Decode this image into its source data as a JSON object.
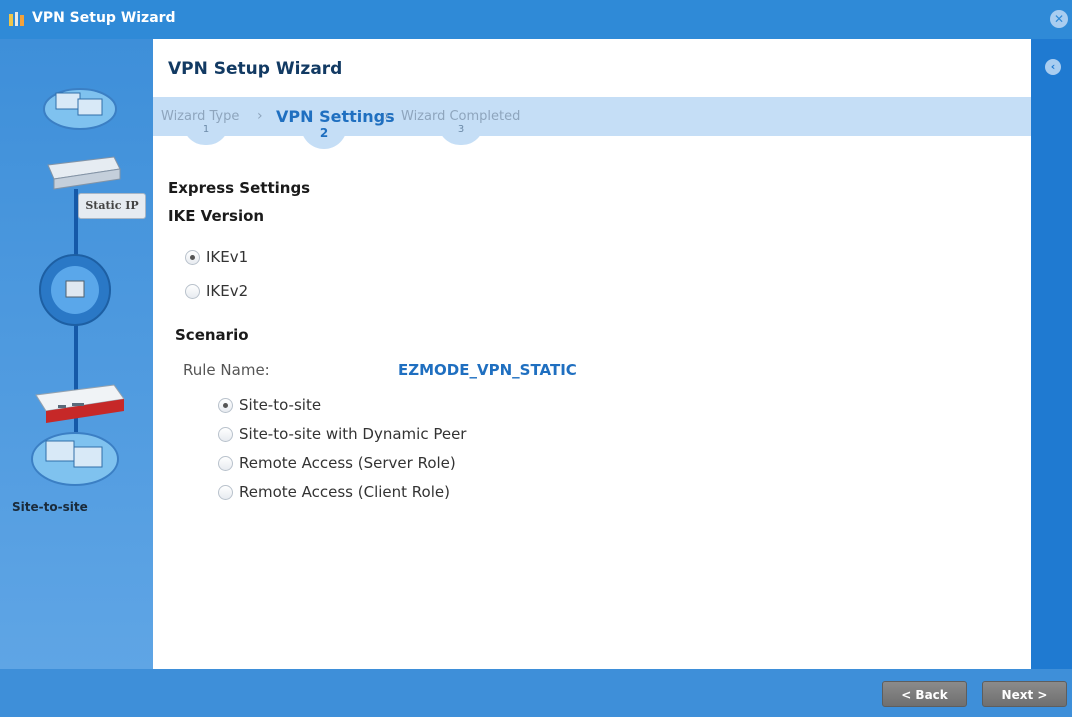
{
  "window": {
    "title": "VPN Setup Wizard",
    "close_icon": "close-icon"
  },
  "sidebar": {
    "static_ip_label": "Static IP",
    "scenario_label": "Site-to-site"
  },
  "main": {
    "title": "VPN Setup Wizard",
    "steps": [
      {
        "label": "Wizard Type",
        "number": "1",
        "active": false
      },
      {
        "label": "VPN Settings",
        "number": "2",
        "active": true
      },
      {
        "label": "Wizard Completed",
        "number": "3",
        "active": false
      }
    ],
    "express_settings": "Express Settings",
    "ike": {
      "heading": "IKE Version",
      "options": [
        {
          "label": "IKEv1",
          "checked": true
        },
        {
          "label": "IKEv2",
          "checked": false
        }
      ]
    },
    "scenario": {
      "heading": "Scenario",
      "rule_name_label": "Rule Name:",
      "rule_name_value": "EZMODE_VPN_STATIC",
      "options": [
        {
          "label": "Site-to-site",
          "checked": true
        },
        {
          "label": "Site-to-site with Dynamic Peer",
          "checked": false
        },
        {
          "label": "Remote Access (Server Role)",
          "checked": false
        },
        {
          "label": "Remote Access (Client Role)",
          "checked": false
        }
      ]
    }
  },
  "footer": {
    "back_label": "< Back",
    "next_label": "Next >"
  },
  "colors": {
    "accent": "#2f8ad7",
    "active_step": "#1f6fc0",
    "title_text": "#123a63"
  }
}
